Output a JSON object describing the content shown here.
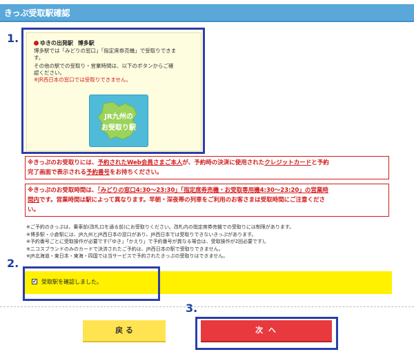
{
  "header": {
    "title": "きっぷ受取駅確認"
  },
  "steps": {
    "one": "1.",
    "two": "2.",
    "three": "3."
  },
  "station_box": {
    "station_label": "ゆきの出発駅",
    "station_name": "博多駅",
    "line1": "博多駅では「みどりの窓口」「指定席券売機」で受取りできま",
    "line2": "す。",
    "line3": "その他の駅での受取り・営業時間は、以下のボタンからご確",
    "line4": "認ください。",
    "line5": "※JR西日本の窓口では受取りできません。",
    "button_line1": "JR九州の",
    "button_line2": "お受取り駅",
    "button_color": "#4fbbd8",
    "icon": "kyushu-map-icon"
  },
  "notice1": {
    "p1": "※きっぷのお受取りには、",
    "link1": "予約されたWeb会員さまご本人",
    "p2": "が、予約時の決済に使用された",
    "link2": "クレジットカード",
    "p3": "と予約",
    "p4": "完了画面で表示される",
    "link3": "予約番号",
    "p5": "をお持ちください。"
  },
  "notice2": {
    "p1": "※きっぷのお受取時間は、",
    "link1": "「みどりの窓口4:30〜23:30」「指定席券売機・お受取専用機4:30〜23:20」の営業時",
    "link2": "間内",
    "p2": "です。営業時間は駅によって異なります。早朝・深夜帯の列車をご利用のお客さまは受取時間にご注意くださ",
    "p3": "い。"
  },
  "notes": [
    "※ご予約のきっぷは、乗車前(改札口を通る前)にお受取りください。改札内の指定席券売機での受取りには制限があります。",
    "※博多駅・小倉駅には、JR九州とJR西日本の窓口があり、JR西日本では受取りできないきっぷがあります。",
    "※予約番号ごとに受取操作が必要です(「ゆき」「かえり」で予約番号が異なる場合は、受取操作が2回必要です)。",
    "※ニコスブランドのみのカードで決済されたご予約は、JR西日本の駅で受取りできません。",
    "※JR北海道・東日本・東海・四国では当サービスで予約されたきっぷの受取りはできません。"
  ],
  "confirm": {
    "label": "受取駅を確認しました。",
    "checked": true
  },
  "buttons": {
    "back": "戻 る",
    "next": "次 へ"
  },
  "colors": {
    "header": "#5aa8da",
    "accent_red": "#d21a1a",
    "confirm_bar": "#fff100",
    "back_button": "#ffe350",
    "next_button": "#e8393e",
    "highlight_frame": "#2a3ea8"
  }
}
